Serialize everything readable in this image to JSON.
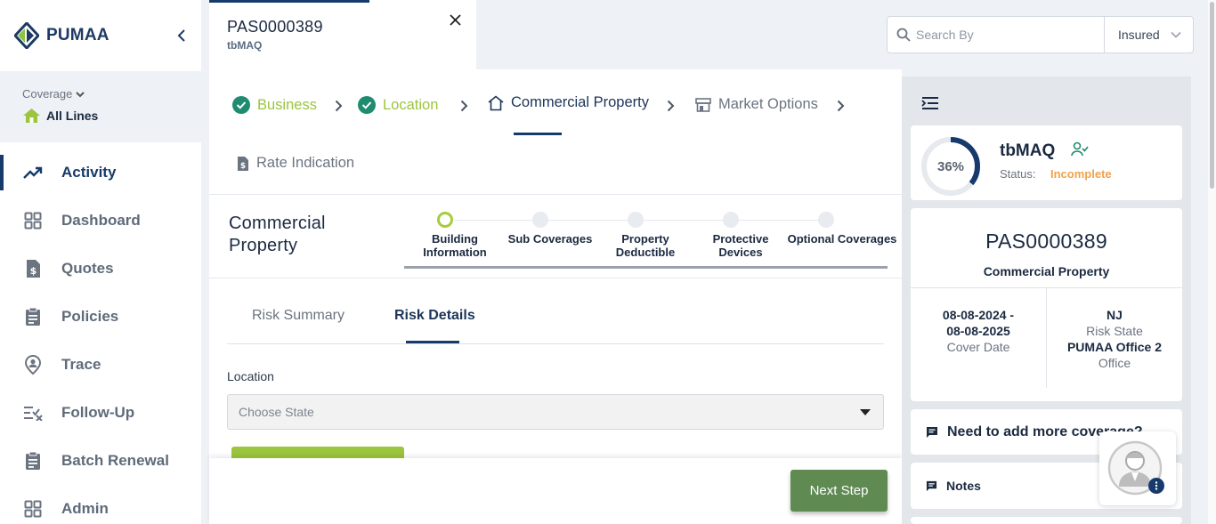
{
  "brand": {
    "name": "PUMAA"
  },
  "coverage": {
    "label": "Coverage",
    "value": "All Lines"
  },
  "nav": [
    {
      "label": "Activity",
      "icon": "trending-up-icon"
    },
    {
      "label": "Dashboard",
      "icon": "dashboard-grid-icon"
    },
    {
      "label": "Quotes",
      "icon": "dollar-doc-icon"
    },
    {
      "label": "Policies",
      "icon": "clipboard-icon"
    },
    {
      "label": "Trace",
      "icon": "location-pin-icon"
    },
    {
      "label": "Follow-Up",
      "icon": "checklist-icon"
    },
    {
      "label": "Batch Renewal",
      "icon": "clipboard-icon"
    },
    {
      "label": "Admin",
      "icon": "grid-icon"
    }
  ],
  "tab": {
    "title": "PAS0000389",
    "subtitle": "tbMAQ"
  },
  "search": {
    "placeholder": "Search By",
    "filter": "Insured"
  },
  "steps": [
    {
      "label": "Business",
      "state": "done"
    },
    {
      "label": "Location",
      "state": "done"
    },
    {
      "label": "Commercial Property",
      "state": "current"
    },
    {
      "label": "Market Options",
      "state": "todo"
    },
    {
      "label": "Rate Indication",
      "state": "todo"
    }
  ],
  "section": {
    "title": "Commercial Property"
  },
  "substeps": [
    {
      "line1": "Building",
      "line2": "Information"
    },
    {
      "line1": "Sub Coverages",
      "line2": ""
    },
    {
      "line1": "Property",
      "line2": "Deductible"
    },
    {
      "line1": "Protective",
      "line2": "Devices"
    },
    {
      "line1": "Optional Coverages",
      "line2": ""
    }
  ],
  "subtabs": {
    "risk_summary": "Risk Summary",
    "risk_details": "Risk Details"
  },
  "form": {
    "location_label": "Location",
    "state_placeholder": "Choose State"
  },
  "actions": {
    "next": "Next Step"
  },
  "status_card": {
    "percent": 36,
    "percent_label": "36%",
    "name": "tbMAQ",
    "status_label": "Status:",
    "status_value": "Incomplete"
  },
  "policy": {
    "number": "PAS0000389",
    "type": "Commercial Property",
    "date_start": "08-08-2024 -",
    "date_end": "08-08-2025",
    "date_label": "Cover Date",
    "state": "NJ",
    "state_label": "Risk State",
    "office": "PUMAA Office 2",
    "office_label": "Office"
  },
  "links": {
    "more_coverage": "Need to add more coverage?",
    "notes": "Notes"
  },
  "colors": {
    "primary": "#173a6c",
    "done_green": "#9bc53d",
    "check_teal": "#1f8c6f",
    "incomplete": "#f0a24a",
    "next_btn": "#5f8a52"
  }
}
